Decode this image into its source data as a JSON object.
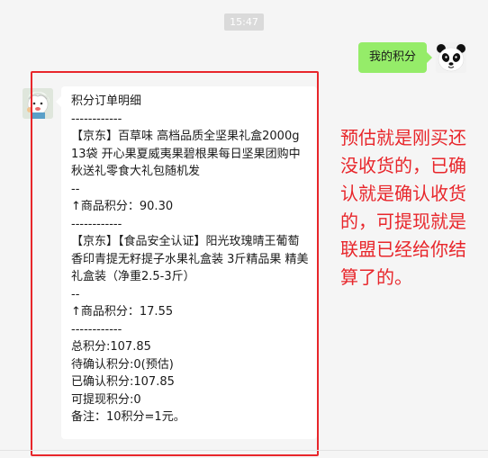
{
  "chat": {
    "timestamp": "15:47",
    "outgoing": {
      "text": "我的积分"
    },
    "incoming": {
      "title": "积分订单明细",
      "separator": "------------",
      "item1_name": "【京东】百草味 高档品质全坚果礼盒2000g 13袋 开心果夏威夷果碧根果每日坚果团购中秋送礼零食大礼包随机发",
      "item_sep": "--",
      "item1_points": "↑商品积分：90.30",
      "item2_name": "【京东】【食品安全认证】阳光玫瑰晴王葡萄香印青提无籽提子水果礼盒装 3斤精品果 精美礼盒装（净重2.5-3斤）",
      "item2_points": "↑商品积分：17.55",
      "total": "总积分:107.85",
      "pending": "待确认积分:0(预估)",
      "confirmed": "已确认积分:107.85",
      "withdrawable": "可提现积分:0",
      "note": "备注：10积分=1元。"
    }
  },
  "annotation": {
    "text": "预估就是刚买还没收货的，已确认就是确认收货的，可提现就是联盟已经给你结算了的。"
  },
  "colors": {
    "outgoing_bubble": "#95ec69",
    "incoming_bubble": "#ffffff",
    "highlight": "#e8262b",
    "background": "#f5f5f5"
  },
  "icons": {
    "self_avatar": "panda-avatar-icon",
    "other_avatar": "cartoon-avatar-icon"
  }
}
